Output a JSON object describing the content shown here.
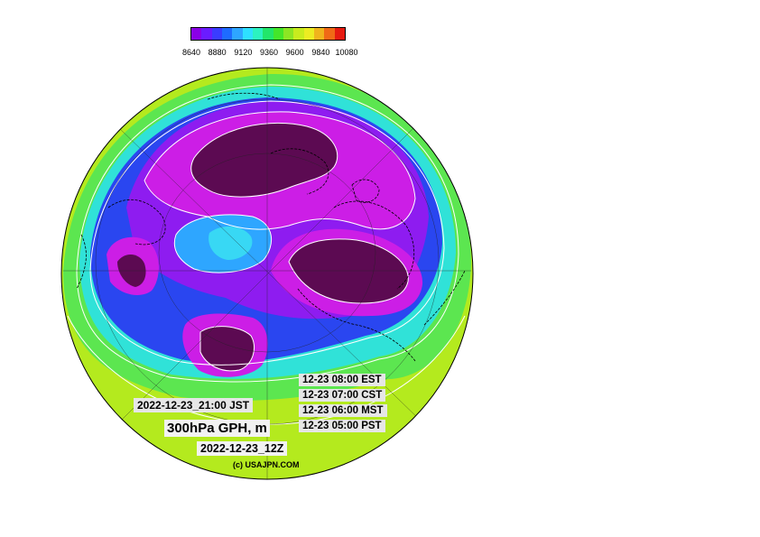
{
  "colorbar": {
    "colors": [
      "#8a00e6",
      "#6a1cff",
      "#3a3cff",
      "#1e6bff",
      "#2ea6ff",
      "#2ee0ff",
      "#2cf2c0",
      "#22e66a",
      "#44e62a",
      "#8ce624",
      "#c8ec1e",
      "#ecec22",
      "#f0b41c",
      "#f06a16",
      "#e61a10"
    ],
    "tick_labels": [
      "8640",
      "8880",
      "9120",
      "9360",
      "9600",
      "9840",
      "10080"
    ]
  },
  "labels": {
    "tz_est": "12-23 08:00 EST",
    "tz_cst": "12-23 07:00 CST",
    "tz_mst": "12-23 06:00 MST",
    "tz_pst": "12-23 05:00 PST",
    "jst": "2022-12-23_21:00 JST",
    "title": "300hPa GPH, m",
    "run": "2022-12-23_12Z",
    "credit": "(c) USAJPN.COM"
  },
  "map_colors": {
    "low_core": "#5c0a52",
    "magenta": "#cc1ee6",
    "purple": "#8e1cf0",
    "blue": "#2a46f0",
    "cyan": "#38c8f4",
    "teal": "#30e2d8",
    "green": "#2ce060",
    "yellowgreen": "#8ee620",
    "lime": "#b4ea1e"
  }
}
